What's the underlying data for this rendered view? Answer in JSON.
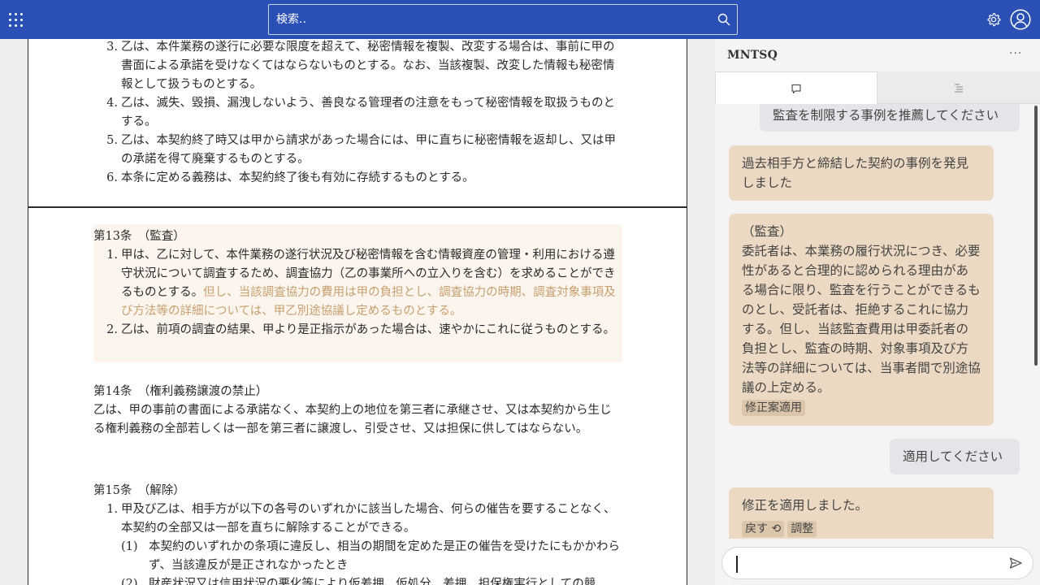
{
  "header": {
    "search_placeholder": "検索.."
  },
  "document": {
    "art12_items": [
      {
        "num": "3.",
        "text": "乙は、本件業務の遂行に必要な限度を超えて、秘密情報を複製、改変する場合は、事前に甲の書面による承諾を受けなくてはならないものとする。なお、当該複製、改変した情報も秘密情報として扱うものとする。"
      },
      {
        "num": "4.",
        "text": "乙は、滅失、毀損、漏洩しないよう、善良なる管理者の注意をもって秘密情報を取扱うものとする。"
      },
      {
        "num": "5.",
        "text": "乙は、本契約終了時又は甲から請求があった場合には、甲に直ちに秘密情報を返却し、又は甲の承諾を得て廃棄するものとする。"
      },
      {
        "num": "6.",
        "text": "本条に定める義務は、本契約終了後も有効に存続するものとする。"
      }
    ],
    "art13": {
      "title": "第13条　（監査）",
      "item1_num": "1.",
      "item1_text": "甲は、乙に対して、本件業務の遂行状況及び秘密情報を含む情報資産の管理・利用における遵守状況について調査するため、調査協力（乙の事業所への立入りを含む）を求めることができるものとする。",
      "item1_amended": "但し、当該調査協力の費用は甲の負担とし、調査協力の時期、調査対象事項及び方法等の詳細については、甲乙別途協議し定めるものとする。",
      "item2_num": "2.",
      "item2_text": "乙は、前項の調査の結果、甲より是正指示があった場合は、速やかにこれに従うものとする。"
    },
    "art14": {
      "title": "第14条　（権利義務譲渡の禁止）",
      "text": "乙は、甲の事前の書面による承諾なく、本契約上の地位を第三者に承継させ、又は本契約から生じる権利義務の全部若しくは一部を第三者に譲渡し、引受させ、又は担保に供してはならない。"
    },
    "art15": {
      "title": "第15条　（解除）",
      "item1_num": "1.",
      "item1_text": "甲及び乙は、相手方が以下の各号のいずれかに該当した場合、何らの催告を要することなく、本契約の全部又は一部を直ちに解除することができる。",
      "sub1_num": "(1)",
      "sub1_text": "本契約のいずれかの条項に違反し、相当の期間を定めた是正の催告を受けたにもかかわらず、当該違反が是正されなかったとき",
      "sub2_num": "(2)",
      "sub2_text": "財産状況又は信用状況の悪化等により仮差押、仮処分、差押、担保権実行としての競"
    }
  },
  "panel": {
    "brand": "MNTSQ",
    "more": "···",
    "messages": [
      {
        "role": "user",
        "text": "監査を制限する事例を推薦してください"
      },
      {
        "role": "bot",
        "text": "過去相手方と締結した契約の事例を発見しました"
      },
      {
        "role": "bot",
        "text": "（監査）\n委託者は、本業務の履行状況につき、必要性があると合理的に認められる理由がある場合に限り、監査を行うことができるものとし、受託者は、拒絶するこれに協力する。但し、当該監査費用は甲委託者の負担とし、監査の時期、対象事項及び方法等の詳細については、当事者間で別途協議の上定める。",
        "action": "修正案適用"
      },
      {
        "role": "user",
        "text": "適用してください"
      },
      {
        "role": "bot",
        "text": "修正を適用しました。",
        "actions": [
          "戻す ⟲",
          "調整"
        ]
      }
    ],
    "composer_value": ""
  }
}
